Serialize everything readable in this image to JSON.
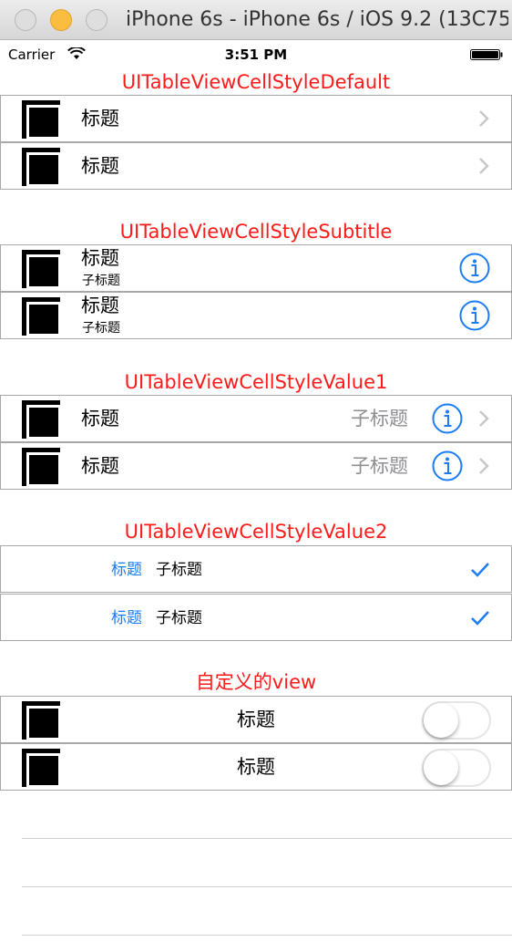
{
  "window": {
    "title": "iPhone 6s - iPhone 6s / iOS 9.2 (13C75)"
  },
  "status_bar": {
    "carrier": "Carrier",
    "time": "3:51 PM"
  },
  "sections": [
    {
      "header": "UITableViewCellStyleDefault",
      "rows": [
        {
          "title": "标题"
        },
        {
          "title": "标题"
        }
      ]
    },
    {
      "header": "UITableViewCellStyleSubtitle",
      "rows": [
        {
          "title": "标题",
          "subtitle": "子标题"
        },
        {
          "title": "标题",
          "subtitle": "子标题"
        }
      ]
    },
    {
      "header": "UITableViewCellStyleValue1",
      "rows": [
        {
          "title": "标题",
          "detail": "子标题"
        },
        {
          "title": "标题",
          "detail": "子标题"
        }
      ]
    },
    {
      "header": "UITableViewCellStyleValue2",
      "rows": [
        {
          "title": "标题",
          "detail": "子标题"
        },
        {
          "title": "标题",
          "detail": "子标题"
        }
      ]
    },
    {
      "header": "自定义的view",
      "rows": [
        {
          "title": "标题",
          "switch_on": false
        },
        {
          "title": "标题",
          "switch_on": false
        }
      ]
    }
  ],
  "colors": {
    "header": "#ff1a1a",
    "tint": "#1a7cf7",
    "detail_gray": "#8e8e93"
  },
  "icons": {
    "accessory_default": "chevron-right-icon",
    "accessory_subtitle": "info-icon",
    "accessory_value1": "info-and-chevron-icon",
    "accessory_value2": "checkmark-icon",
    "thumbnail": "black-square-image"
  }
}
